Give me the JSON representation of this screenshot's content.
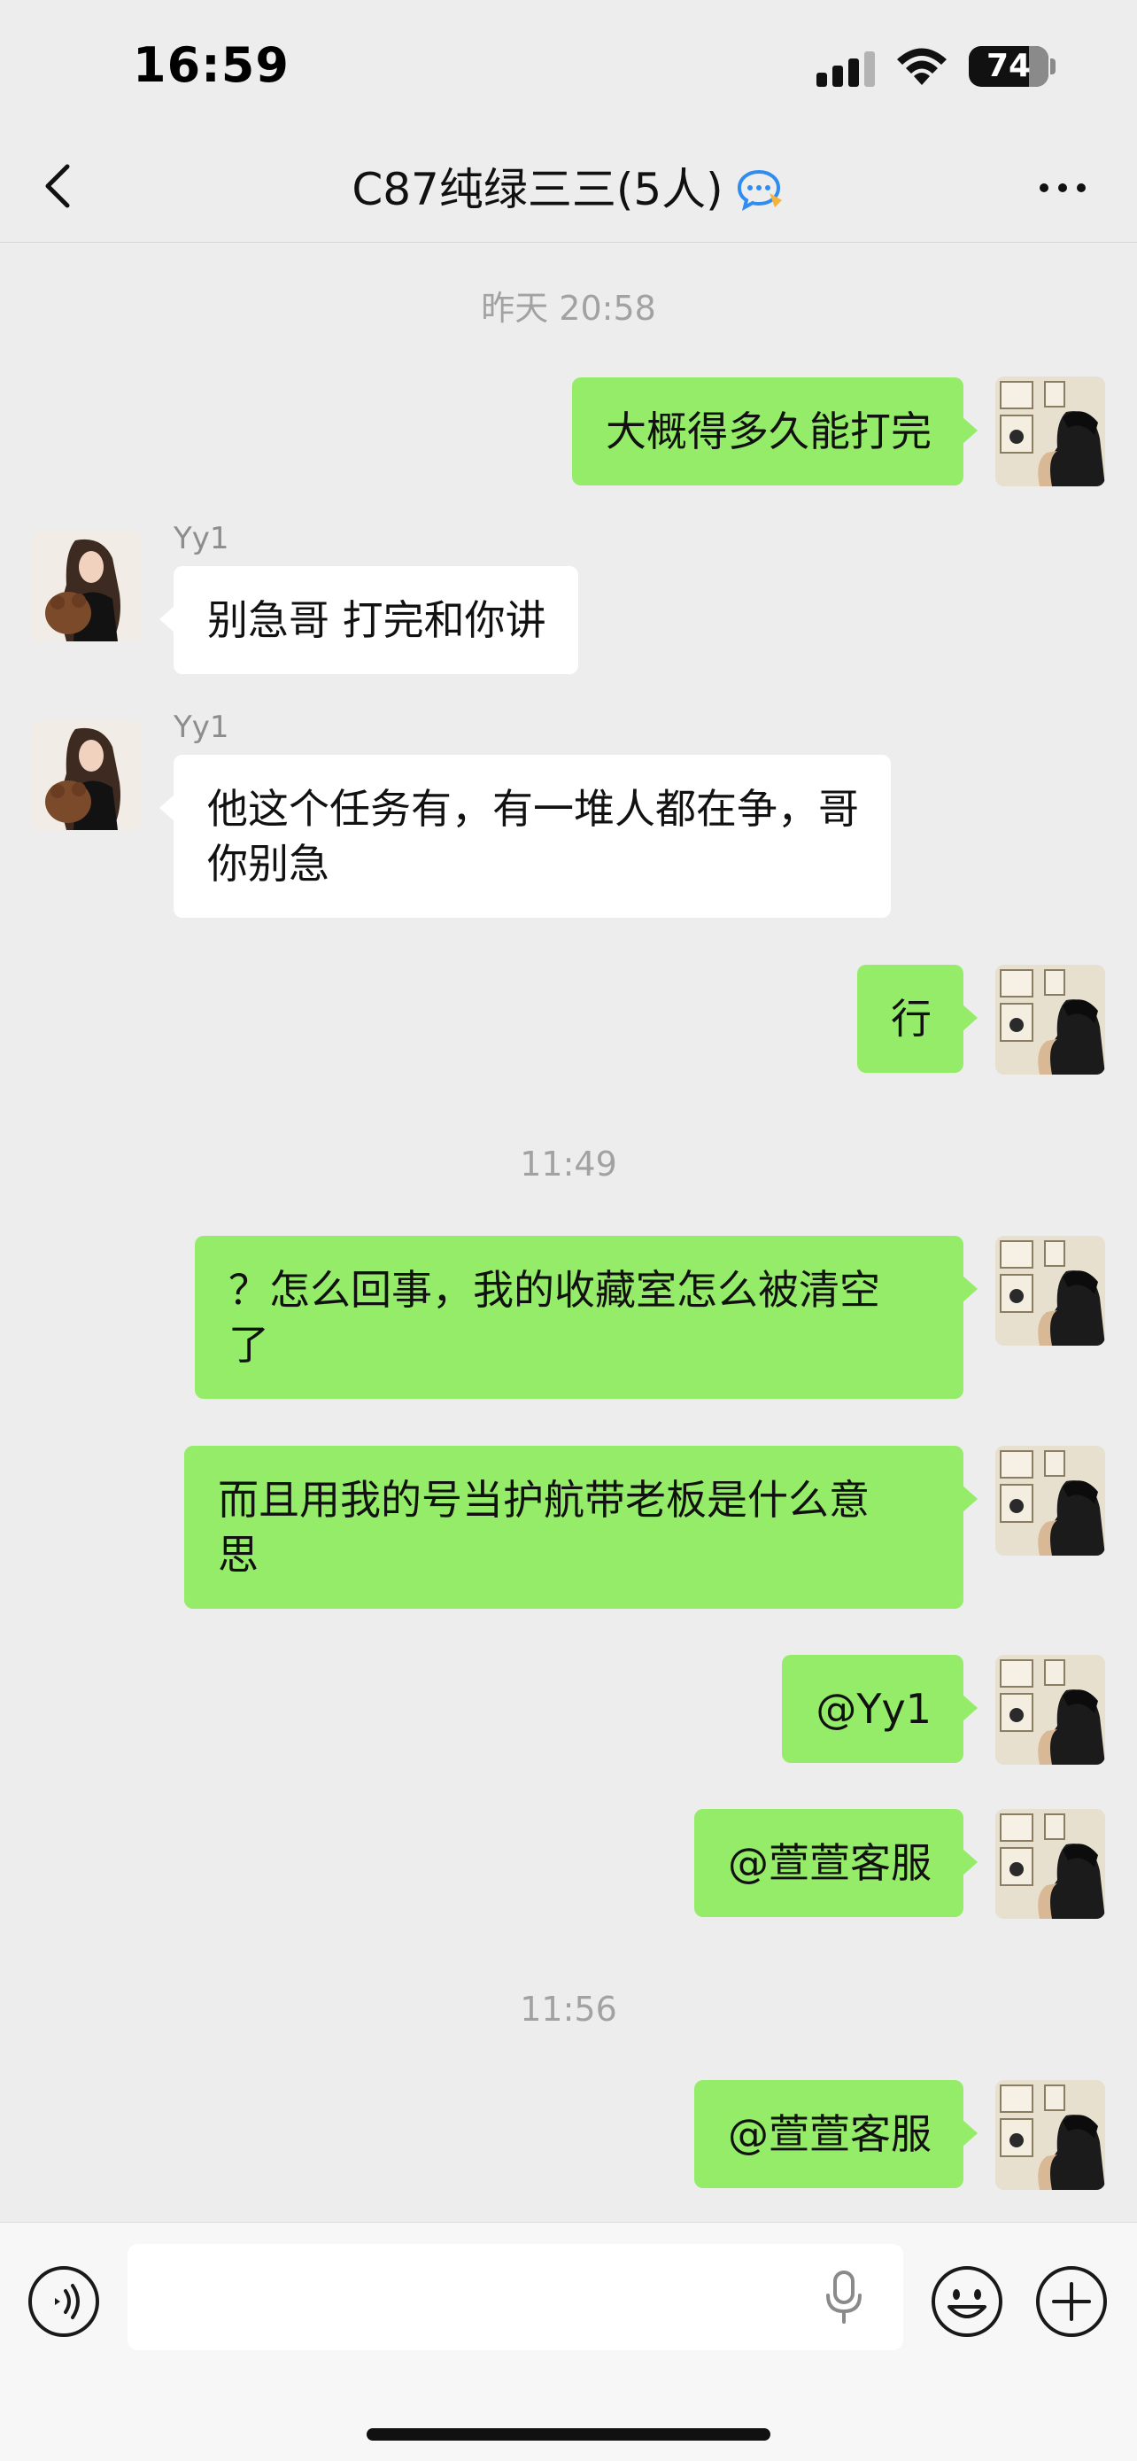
{
  "status_bar": {
    "time": "16:59",
    "battery": "74"
  },
  "header": {
    "title": "C87纯绿三三(5人)",
    "badge_icon": "chat-bubble-icon",
    "back_icon": "chevron-left-icon",
    "more_icon": "more-dots-icon"
  },
  "messages": [
    {
      "type": "timestamp",
      "text": "昨天 20:58"
    },
    {
      "type": "msg",
      "from": "self",
      "text": "大概得多久能打完"
    },
    {
      "type": "msg",
      "from": "other",
      "sender": "Yy1",
      "text": "别急哥 打完和你讲"
    },
    {
      "type": "msg",
      "from": "other",
      "sender": "Yy1",
      "text_lines": [
        "他这个任务有，有一堆人都在争，哥",
        "你别急"
      ]
    },
    {
      "type": "msg",
      "from": "self",
      "text": "行"
    },
    {
      "type": "timestamp",
      "text": "11:49"
    },
    {
      "type": "msg",
      "from": "self",
      "text_lines": [
        "？怎么回事，我的收藏室怎么被清空",
        "了"
      ]
    },
    {
      "type": "msg",
      "from": "self",
      "text_lines": [
        "而且用我的号当护航带老板是什么意",
        "思"
      ]
    },
    {
      "type": "msg",
      "from": "self",
      "text": "@Yy1"
    },
    {
      "type": "msg",
      "from": "self",
      "text": "@萱萱客服"
    },
    {
      "type": "timestamp",
      "text": "11:56"
    },
    {
      "type": "msg",
      "from": "self",
      "text": "@萱萱客服"
    }
  ],
  "input_bar": {
    "placeholder": "",
    "voice_icon": "voice-wave-icon",
    "mic_icon": "microphone-icon",
    "emoji_icon": "smiley-icon",
    "plus_icon": "plus-circle-icon"
  },
  "colors": {
    "self_bubble": "#95ec69",
    "other_bubble": "#ffffff",
    "background": "#ededed"
  }
}
